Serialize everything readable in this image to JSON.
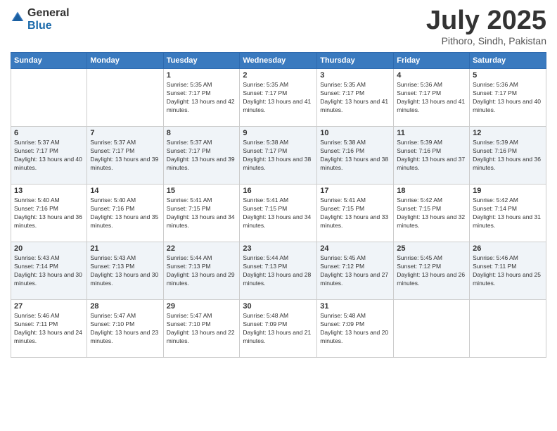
{
  "logo": {
    "general": "General",
    "blue": "Blue"
  },
  "title": {
    "month_year": "July 2025",
    "location": "Pithoro, Sindh, Pakistan"
  },
  "days_of_week": [
    "Sunday",
    "Monday",
    "Tuesday",
    "Wednesday",
    "Thursday",
    "Friday",
    "Saturday"
  ],
  "weeks": [
    [
      {
        "day": "",
        "sunrise": "",
        "sunset": "",
        "daylight": ""
      },
      {
        "day": "",
        "sunrise": "",
        "sunset": "",
        "daylight": ""
      },
      {
        "day": "1",
        "sunrise": "Sunrise: 5:35 AM",
        "sunset": "Sunset: 7:17 PM",
        "daylight": "Daylight: 13 hours and 42 minutes."
      },
      {
        "day": "2",
        "sunrise": "Sunrise: 5:35 AM",
        "sunset": "Sunset: 7:17 PM",
        "daylight": "Daylight: 13 hours and 41 minutes."
      },
      {
        "day": "3",
        "sunrise": "Sunrise: 5:35 AM",
        "sunset": "Sunset: 7:17 PM",
        "daylight": "Daylight: 13 hours and 41 minutes."
      },
      {
        "day": "4",
        "sunrise": "Sunrise: 5:36 AM",
        "sunset": "Sunset: 7:17 PM",
        "daylight": "Daylight: 13 hours and 41 minutes."
      },
      {
        "day": "5",
        "sunrise": "Sunrise: 5:36 AM",
        "sunset": "Sunset: 7:17 PM",
        "daylight": "Daylight: 13 hours and 40 minutes."
      }
    ],
    [
      {
        "day": "6",
        "sunrise": "Sunrise: 5:37 AM",
        "sunset": "Sunset: 7:17 PM",
        "daylight": "Daylight: 13 hours and 40 minutes."
      },
      {
        "day": "7",
        "sunrise": "Sunrise: 5:37 AM",
        "sunset": "Sunset: 7:17 PM",
        "daylight": "Daylight: 13 hours and 39 minutes."
      },
      {
        "day": "8",
        "sunrise": "Sunrise: 5:37 AM",
        "sunset": "Sunset: 7:17 PM",
        "daylight": "Daylight: 13 hours and 39 minutes."
      },
      {
        "day": "9",
        "sunrise": "Sunrise: 5:38 AM",
        "sunset": "Sunset: 7:17 PM",
        "daylight": "Daylight: 13 hours and 38 minutes."
      },
      {
        "day": "10",
        "sunrise": "Sunrise: 5:38 AM",
        "sunset": "Sunset: 7:16 PM",
        "daylight": "Daylight: 13 hours and 38 minutes."
      },
      {
        "day": "11",
        "sunrise": "Sunrise: 5:39 AM",
        "sunset": "Sunset: 7:16 PM",
        "daylight": "Daylight: 13 hours and 37 minutes."
      },
      {
        "day": "12",
        "sunrise": "Sunrise: 5:39 AM",
        "sunset": "Sunset: 7:16 PM",
        "daylight": "Daylight: 13 hours and 36 minutes."
      }
    ],
    [
      {
        "day": "13",
        "sunrise": "Sunrise: 5:40 AM",
        "sunset": "Sunset: 7:16 PM",
        "daylight": "Daylight: 13 hours and 36 minutes."
      },
      {
        "day": "14",
        "sunrise": "Sunrise: 5:40 AM",
        "sunset": "Sunset: 7:16 PM",
        "daylight": "Daylight: 13 hours and 35 minutes."
      },
      {
        "day": "15",
        "sunrise": "Sunrise: 5:41 AM",
        "sunset": "Sunset: 7:15 PM",
        "daylight": "Daylight: 13 hours and 34 minutes."
      },
      {
        "day": "16",
        "sunrise": "Sunrise: 5:41 AM",
        "sunset": "Sunset: 7:15 PM",
        "daylight": "Daylight: 13 hours and 34 minutes."
      },
      {
        "day": "17",
        "sunrise": "Sunrise: 5:41 AM",
        "sunset": "Sunset: 7:15 PM",
        "daylight": "Daylight: 13 hours and 33 minutes."
      },
      {
        "day": "18",
        "sunrise": "Sunrise: 5:42 AM",
        "sunset": "Sunset: 7:15 PM",
        "daylight": "Daylight: 13 hours and 32 minutes."
      },
      {
        "day": "19",
        "sunrise": "Sunrise: 5:42 AM",
        "sunset": "Sunset: 7:14 PM",
        "daylight": "Daylight: 13 hours and 31 minutes."
      }
    ],
    [
      {
        "day": "20",
        "sunrise": "Sunrise: 5:43 AM",
        "sunset": "Sunset: 7:14 PM",
        "daylight": "Daylight: 13 hours and 30 minutes."
      },
      {
        "day": "21",
        "sunrise": "Sunrise: 5:43 AM",
        "sunset": "Sunset: 7:13 PM",
        "daylight": "Daylight: 13 hours and 30 minutes."
      },
      {
        "day": "22",
        "sunrise": "Sunrise: 5:44 AM",
        "sunset": "Sunset: 7:13 PM",
        "daylight": "Daylight: 13 hours and 29 minutes."
      },
      {
        "day": "23",
        "sunrise": "Sunrise: 5:44 AM",
        "sunset": "Sunset: 7:13 PM",
        "daylight": "Daylight: 13 hours and 28 minutes."
      },
      {
        "day": "24",
        "sunrise": "Sunrise: 5:45 AM",
        "sunset": "Sunset: 7:12 PM",
        "daylight": "Daylight: 13 hours and 27 minutes."
      },
      {
        "day": "25",
        "sunrise": "Sunrise: 5:45 AM",
        "sunset": "Sunset: 7:12 PM",
        "daylight": "Daylight: 13 hours and 26 minutes."
      },
      {
        "day": "26",
        "sunrise": "Sunrise: 5:46 AM",
        "sunset": "Sunset: 7:11 PM",
        "daylight": "Daylight: 13 hours and 25 minutes."
      }
    ],
    [
      {
        "day": "27",
        "sunrise": "Sunrise: 5:46 AM",
        "sunset": "Sunset: 7:11 PM",
        "daylight": "Daylight: 13 hours and 24 minutes."
      },
      {
        "day": "28",
        "sunrise": "Sunrise: 5:47 AM",
        "sunset": "Sunset: 7:10 PM",
        "daylight": "Daylight: 13 hours and 23 minutes."
      },
      {
        "day": "29",
        "sunrise": "Sunrise: 5:47 AM",
        "sunset": "Sunset: 7:10 PM",
        "daylight": "Daylight: 13 hours and 22 minutes."
      },
      {
        "day": "30",
        "sunrise": "Sunrise: 5:48 AM",
        "sunset": "Sunset: 7:09 PM",
        "daylight": "Daylight: 13 hours and 21 minutes."
      },
      {
        "day": "31",
        "sunrise": "Sunrise: 5:48 AM",
        "sunset": "Sunset: 7:09 PM",
        "daylight": "Daylight: 13 hours and 20 minutes."
      },
      {
        "day": "",
        "sunrise": "",
        "sunset": "",
        "daylight": ""
      },
      {
        "day": "",
        "sunrise": "",
        "sunset": "",
        "daylight": ""
      }
    ]
  ]
}
